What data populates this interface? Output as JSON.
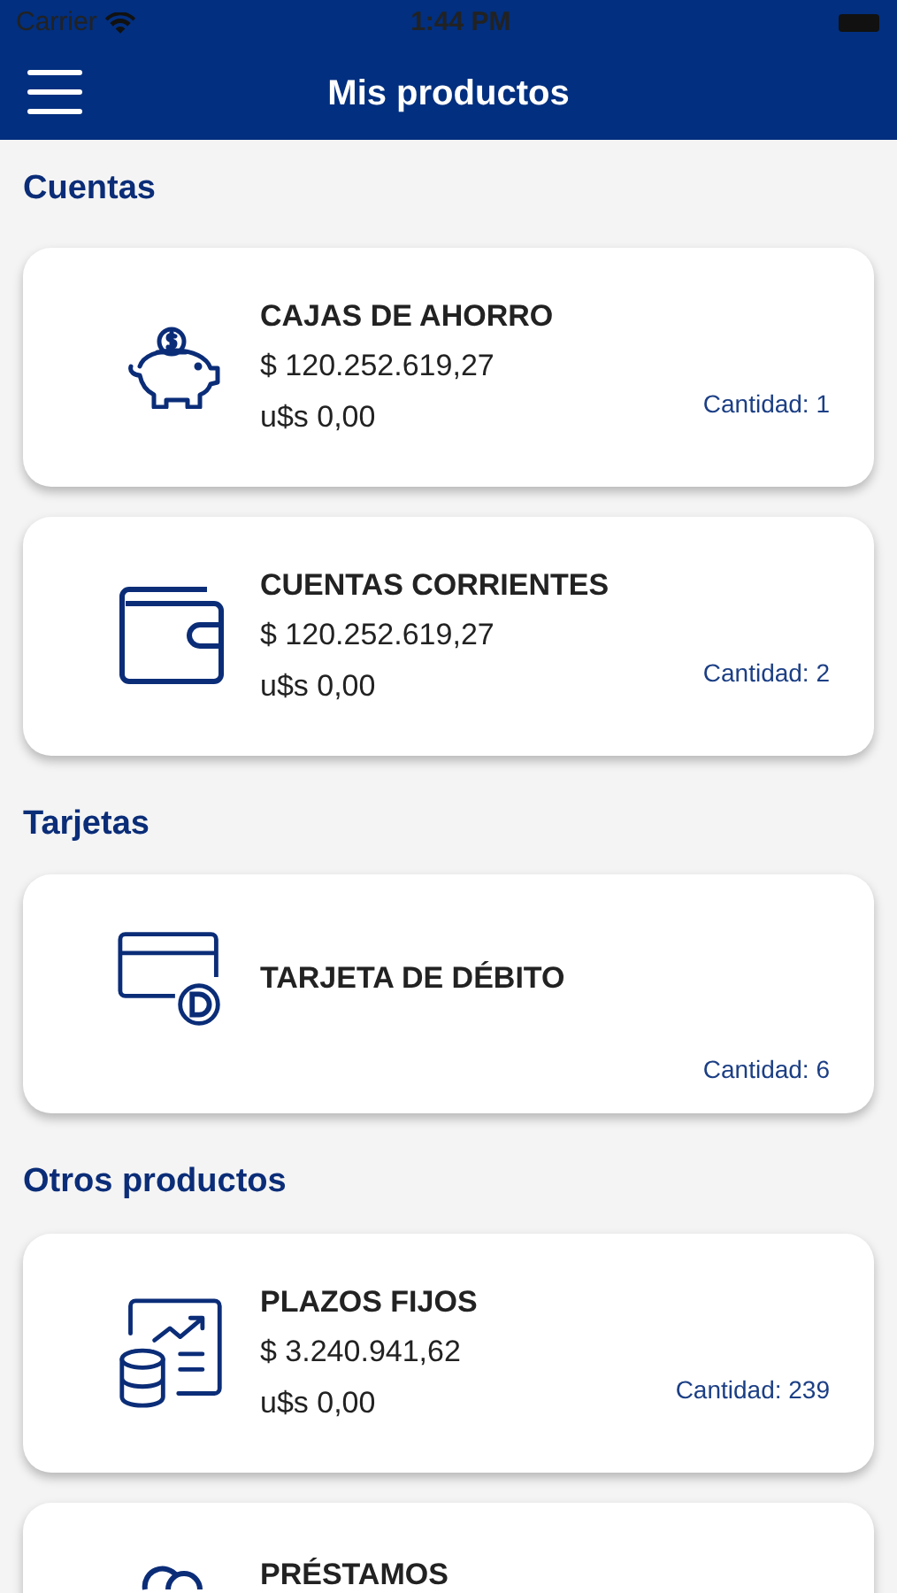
{
  "status_bar": {
    "carrier": "Carrier",
    "time": "1:44 PM"
  },
  "nav_bar": {
    "title": "Mis productos"
  },
  "sections": [
    {
      "title": "Cuentas",
      "products": [
        {
          "kind": "savings",
          "name": "CAJAS DE AHORRO",
          "amounts": [
            "$ 120.252.619,27",
            "u$s 0,00"
          ],
          "count": "Cantidad: 1"
        },
        {
          "kind": "checking",
          "name": "CUENTAS CORRIENTES",
          "amounts": [
            "$ 120.252.619,27",
            "u$s 0,00"
          ],
          "count": "Cantidad: 2"
        }
      ]
    },
    {
      "title": "Tarjetas",
      "products": [
        {
          "kind": "debit",
          "name": "TARJETA DE DÉBITO",
          "count": "Cantidad: 6"
        }
      ]
    },
    {
      "title": "Otros productos",
      "products": [
        {
          "kind": "deposit",
          "name": "PLAZOS FIJOS",
          "amounts": [
            "$ 3.240.941,62",
            "u$s 0,00"
          ],
          "count": "Cantidad: 239"
        },
        {
          "kind": "loan",
          "name": "PRÉSTAMOS"
        }
      ]
    }
  ]
}
